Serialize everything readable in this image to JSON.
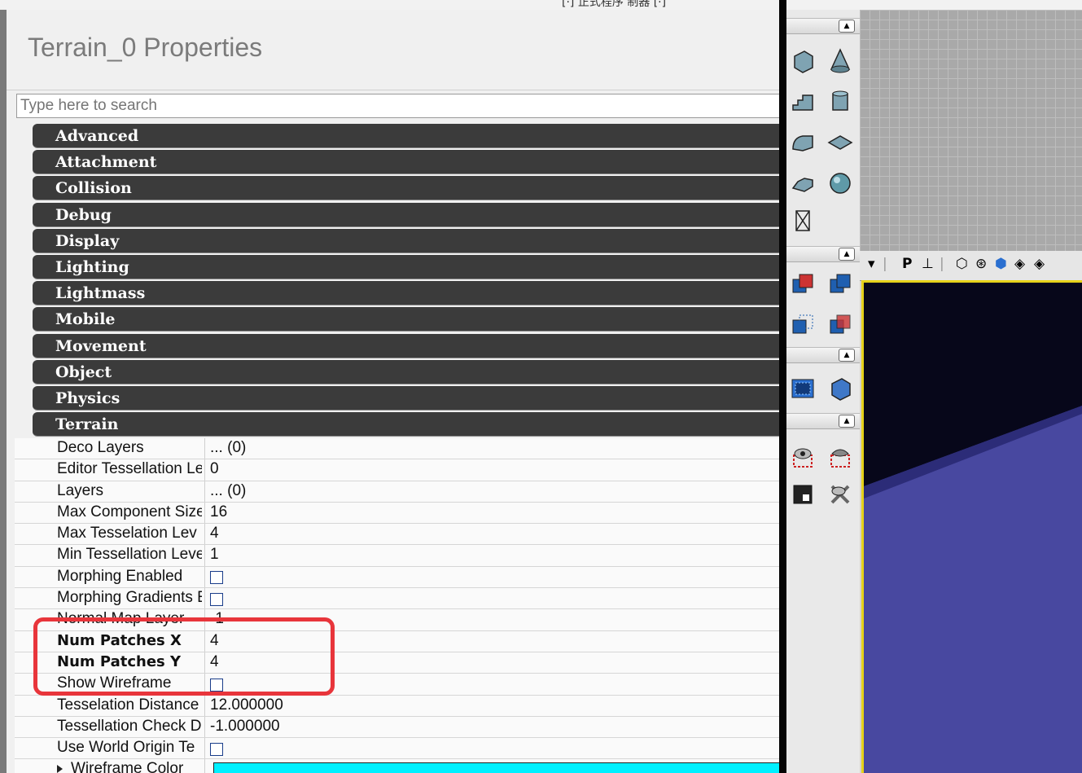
{
  "top_strip": {
    "text": "[·] 正式程序 制器 [·]"
  },
  "properties": {
    "title": "Terrain_0 Properties",
    "search_placeholder": "Type here to search",
    "categories": [
      "Advanced",
      "Attachment",
      "Collision",
      "Debug",
      "Display",
      "Lighting",
      "Lightmass",
      "Mobile",
      "Movement",
      "Object",
      "Physics",
      "Terrain"
    ],
    "rows": [
      {
        "name": "Deco Layers",
        "value": "... (0)",
        "type": "text"
      },
      {
        "name": "Editor Tessellation Le",
        "value": "0",
        "type": "text"
      },
      {
        "name": "Layers",
        "value": "... (0)",
        "type": "text"
      },
      {
        "name": "Max Component Size",
        "value": "16",
        "type": "text"
      },
      {
        "name": "Max Tesselation Lev",
        "value": "4",
        "type": "text"
      },
      {
        "name": "Min Tessellation Leve",
        "value": "1",
        "type": "text"
      },
      {
        "name": "Morphing Enabled",
        "value": "",
        "type": "checkbox"
      },
      {
        "name": "Morphing Gradients E",
        "value": "",
        "type": "checkbox"
      },
      {
        "name": "Normal Map Layer",
        "value": "-1",
        "type": "text"
      },
      {
        "name": "Num Patches X",
        "value": "4",
        "type": "text",
        "bold": true
      },
      {
        "name": "Num Patches Y",
        "value": "4",
        "type": "text",
        "bold": true
      },
      {
        "name": "Show Wireframe",
        "value": "",
        "type": "checkbox"
      },
      {
        "name": "Tesselation Distance",
        "value": "12.000000",
        "type": "text"
      },
      {
        "name": "Tessellation Check D",
        "value": "-1.000000",
        "type": "text"
      },
      {
        "name": "Use World Origin Te",
        "value": "",
        "type": "checkbox"
      },
      {
        "name": "Wireframe Color",
        "value": "",
        "type": "color",
        "color": "#00f0ff",
        "expandable": true
      }
    ],
    "highlight_color": "#e8353b"
  },
  "viewport_toolbar": {
    "perspective_label": "P",
    "icons": [
      "dropdown-icon",
      "perspective-icon",
      "axis-icon",
      "brush-wireframe-icon",
      "wireframe-icon",
      "unlit-icon",
      "lit-icon",
      "detail-lighting-icon"
    ]
  },
  "toolbox": {
    "tools": [
      "cube-brush-icon",
      "cone-brush-icon",
      "stairs-brush-icon",
      "cylinder-brush-icon",
      "curved-stairs-icon",
      "sheet-brush-icon",
      "spiral-stairs-icon",
      "sphere-brush-icon",
      "volumetric-icon",
      "csg-add-icon",
      "csg-subtract-icon",
      "csg-intersect-icon",
      "csg-deintersect-icon",
      "add-volume-icon",
      "add-special-icon",
      "show-selected-icon",
      "hide-selected-icon",
      "select-toggle-icon",
      "invert-selection-icon"
    ]
  }
}
